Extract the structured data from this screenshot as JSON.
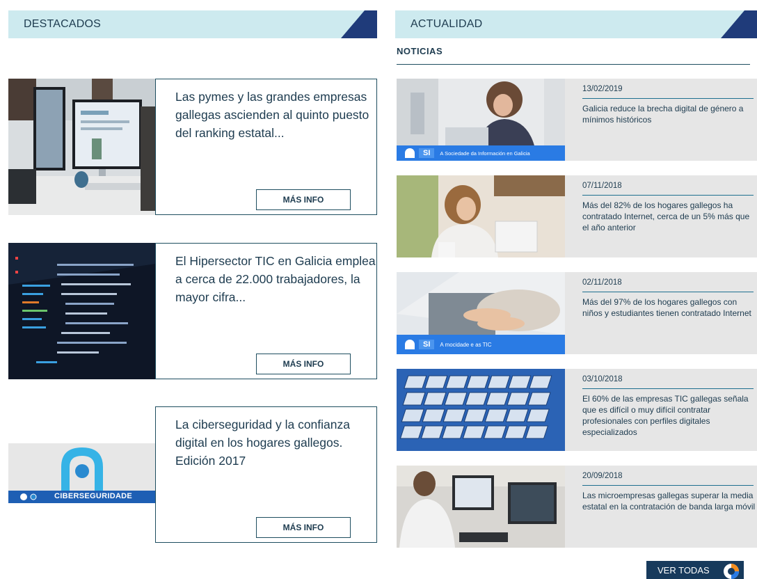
{
  "destacados": {
    "title": "DESTACADOS",
    "items": [
      {
        "headline": "Las pymes y las grandes empresas gallegas ascienden al quinto puesto del ranking estatal...",
        "button": "MÁS INFO",
        "thumb_icon": "office-computers-photo"
      },
      {
        "headline": "El Hipersector TIC en Galicia emplea a cerca de 22.000 trabajadores, la mayor cifra...",
        "button": "MÁS INFO",
        "thumb_icon": "code-screen-photo"
      },
      {
        "headline": "La ciberseguridad y la confianza digital en los hogares gallegos. Edición 2017",
        "button": "MÁS INFO",
        "thumb_icon": "ciberseguridade-logo",
        "thumb_label": "CIBERSEGURIDADE"
      }
    ]
  },
  "actualidad": {
    "title": "ACTUALIDAD",
    "subtitle": "NOTICIAS",
    "news": [
      {
        "date": "13/02/2019",
        "title": "Galicia reduce la brecha digital de género a mínimos históricos",
        "banner_si": "SI",
        "banner_text": "A Sociedade da Información en Galicia"
      },
      {
        "date": "07/11/2018",
        "title": "Más del 82% de los hogares gallegos ha contratado Internet, cerca de un 5% más que el año anterior"
      },
      {
        "date": "02/11/2018",
        "title": "Más del 97% de los hogares gallegos con niños y estudiantes tienen contratado Internet",
        "banner_si": "SI",
        "banner_text": "A mocidade e as TIC"
      },
      {
        "date": "03/10/2018",
        "title": "El 60% de las empresas TIC gallegas señala que es difícil o muy difícil contratar profesionales con perfiles digitales especializados"
      },
      {
        "date": "20/09/2018",
        "title": "Las microempresas gallegas superar la media estatal en la contratación de banda larga móvil"
      }
    ],
    "ver_todas": "VER TODAS"
  },
  "colors": {
    "header_bg": "#cdeaef",
    "header_accent": "#1f3b7a",
    "text": "#1d3b4f",
    "news_bg": "#e6e6e6",
    "si_blue": "#2a7be4",
    "button_dark": "#173a5c"
  }
}
